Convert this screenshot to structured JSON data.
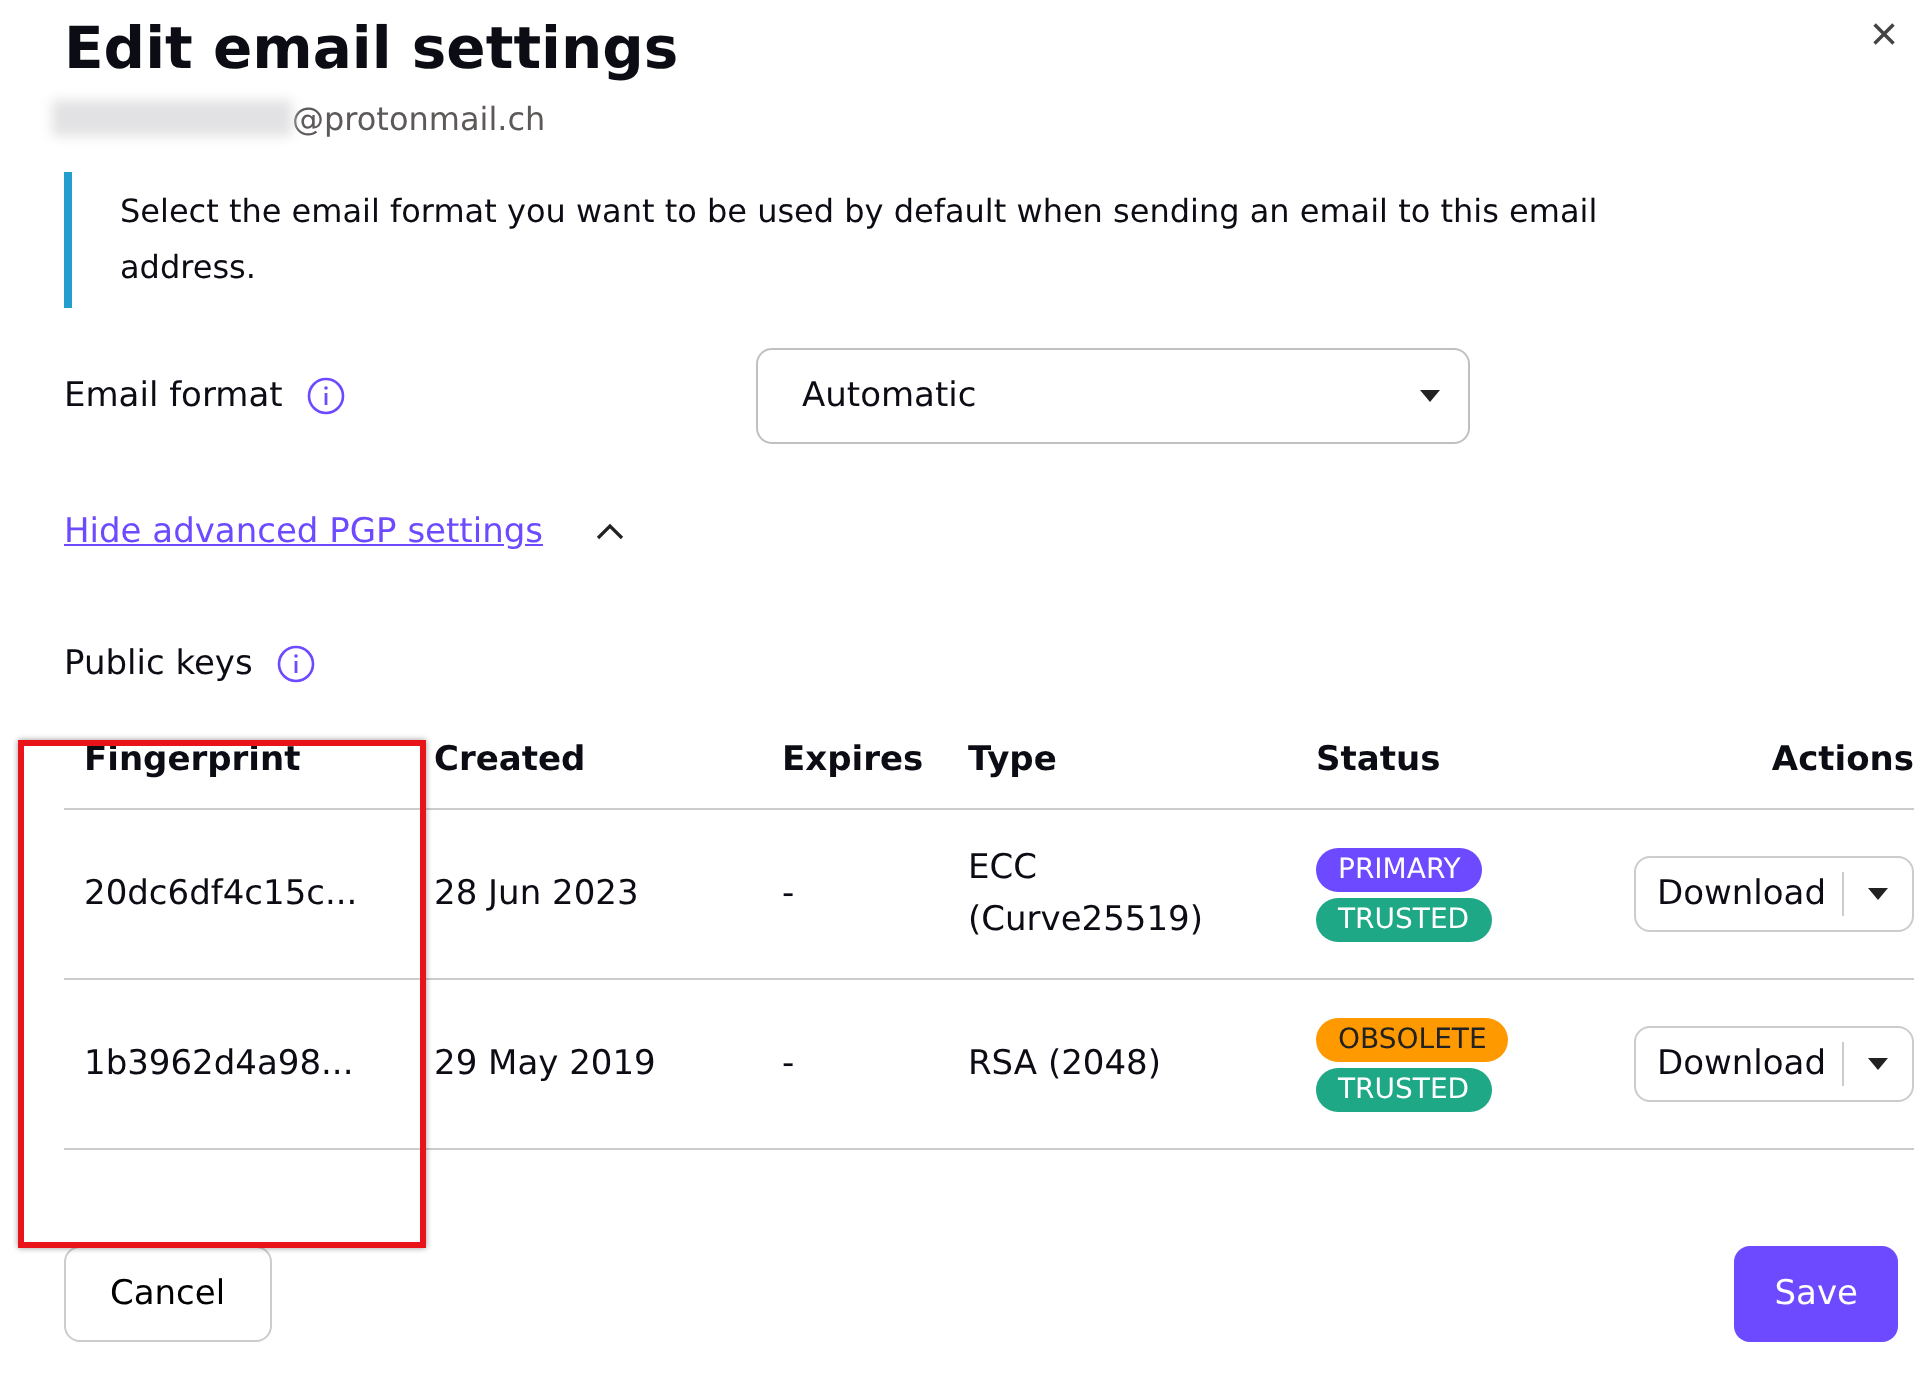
{
  "dialog": {
    "title": "Edit email settings",
    "email_suffix": "@protonmail.ch",
    "close": "×"
  },
  "info": "Select the email format you want to be used by default when sending an email to this email address.",
  "email_format": {
    "label": "Email format",
    "value": "Automatic"
  },
  "advanced_link": {
    "label": "Hide advanced PGP settings",
    "expanded": true
  },
  "public_keys": {
    "label": "Public keys",
    "columns": [
      "Fingerprint",
      "Created",
      "Expires",
      "Type",
      "Status",
      "Actions"
    ],
    "rows": [
      {
        "fingerprint": "20dc6df4c15c...",
        "created": "28 Jun 2023",
        "expires": "-",
        "type": "ECC (Curve25519)",
        "badges": [
          {
            "label": "PRIMARY",
            "color": "#6d4aff"
          },
          {
            "label": "TRUSTED",
            "color": "#1ea885"
          }
        ],
        "action": "Download"
      },
      {
        "fingerprint": "1b3962d4a98...",
        "created": "29 May 2019",
        "expires": "-",
        "type": "RSA (2048)",
        "badges": [
          {
            "label": "OBSOLETE",
            "color": "#ff9900"
          },
          {
            "label": "TRUSTED",
            "color": "#1ea885"
          }
        ],
        "action": "Download"
      }
    ]
  },
  "buttons": {
    "cancel": "Cancel",
    "save": "Save"
  }
}
